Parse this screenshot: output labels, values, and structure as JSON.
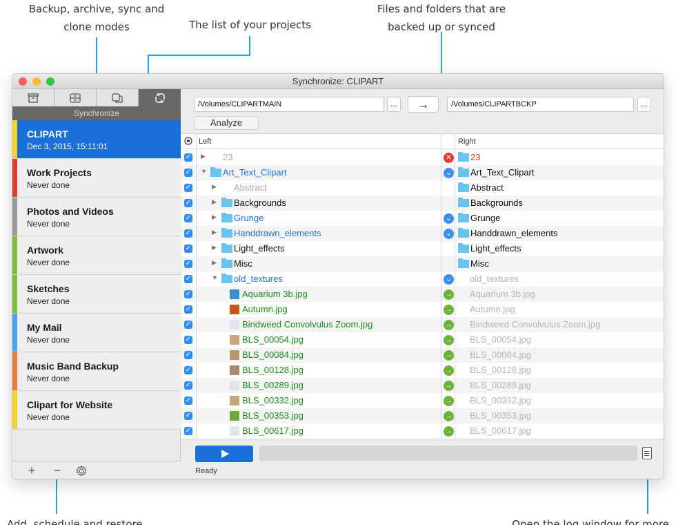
{
  "annotations": {
    "modes": "Backup, archive, sync and clone modes",
    "projects": "The list of your projects",
    "files": "Files and folders that are backed up or synced",
    "add": "Add, schedule and restore",
    "log": "Open the log window for more"
  },
  "window": {
    "title": "Synchronize: CLIPART"
  },
  "sidebar": {
    "mode_label": "Synchronize",
    "modes": [
      {
        "icon": "archive-box-icon"
      },
      {
        "icon": "backup-drive-icon"
      },
      {
        "icon": "clone-icon"
      },
      {
        "icon": "sync-arrows-icon"
      }
    ],
    "projects": [
      {
        "name": "CLIPART",
        "status": "Dec 3, 2015, 15:11:01",
        "color": "#f5d228",
        "selected": true
      },
      {
        "name": "Work Projects",
        "status": "Never done",
        "color": "#e0412f"
      },
      {
        "name": "Photos and Videos",
        "status": "Never done",
        "color": "#9a9a9a"
      },
      {
        "name": "Artwork",
        "status": "Never done",
        "color": "#7dbf3a"
      },
      {
        "name": "Sketches",
        "status": "Never done",
        "color": "#7dbf3a"
      },
      {
        "name": "My Mail",
        "status": "Never done",
        "color": "#4fa3f0"
      },
      {
        "name": "Music Band Backup",
        "status": "Never done",
        "color": "#f07a3a"
      },
      {
        "name": "Clipart for Website",
        "status": "Never done",
        "color": "#f5d228"
      }
    ],
    "footer": {
      "add": "+",
      "remove": "−"
    }
  },
  "main": {
    "left_path": "/Volumes/CLIPARTMAIN",
    "right_path": "/Volumes/CLIPARTBCKP",
    "browse_label": "...",
    "direction_label": "→",
    "analyze_label": "Analyze",
    "col_left": "Left",
    "col_right": "Right",
    "rows": [
      {
        "level": 0,
        "kind": "plain",
        "tri": "right",
        "left": "23",
        "lcolor": "#aaaaaa",
        "status": "error",
        "right": "23",
        "rcolor": "#d8401e",
        "rfolder": true
      },
      {
        "level": 0,
        "kind": "folder",
        "tri": "down",
        "left": "Art_Text_Clipart",
        "lcolor": "#1f72d6",
        "status": "sync",
        "right": "Art_Text_Clipart",
        "rcolor": "#111111",
        "rfolder": true
      },
      {
        "level": 1,
        "kind": "plain",
        "tri": "right",
        "left": "Abstract",
        "lcolor": "#aaaaaa",
        "status": "",
        "right": "Abstract",
        "rcolor": "#111111",
        "rfolder": true
      },
      {
        "level": 1,
        "kind": "folder",
        "tri": "right",
        "left": "Backgrounds",
        "lcolor": "#111111",
        "status": "",
        "right": "Backgrounds",
        "rcolor": "#111111",
        "rfolder": true
      },
      {
        "level": 1,
        "kind": "folder",
        "tri": "right",
        "left": "Grunge",
        "lcolor": "#1f72d6",
        "status": "sync",
        "right": "Grunge",
        "rcolor": "#111111",
        "rfolder": true
      },
      {
        "level": 1,
        "kind": "folder",
        "tri": "right",
        "left": "Handdrawn_elements",
        "lcolor": "#1f72d6",
        "status": "sync",
        "right": "Handdrawn_elements",
        "rcolor": "#111111",
        "rfolder": true
      },
      {
        "level": 1,
        "kind": "folder",
        "tri": "right",
        "left": "Light_effects",
        "lcolor": "#111111",
        "status": "",
        "right": "Light_effects",
        "rcolor": "#111111",
        "rfolder": true
      },
      {
        "level": 1,
        "kind": "folder",
        "tri": "right",
        "left": "Misc",
        "lcolor": "#111111",
        "status": "",
        "right": "Misc",
        "rcolor": "#111111",
        "rfolder": true
      },
      {
        "level": 1,
        "kind": "folder",
        "tri": "down",
        "left": "old_textures",
        "lcolor": "#1f72d6",
        "status": "sync",
        "right": "old_textures",
        "rcolor": "#b5b5b5",
        "rfolder": false
      },
      {
        "level": 2,
        "kind": "file",
        "thumb": "#3c8fd1",
        "left": "Aquarium 3b.jpg",
        "lcolor": "#1d8a1d",
        "status": "copy",
        "right": "Aquarium 3b.jpg",
        "rcolor": "#b5b5b5"
      },
      {
        "level": 2,
        "kind": "file",
        "thumb": "#c2561b",
        "left": "Autumn.jpg",
        "lcolor": "#1d8a1d",
        "status": "copy",
        "right": "Autumn.jpg",
        "rcolor": "#b5b5b5"
      },
      {
        "level": 2,
        "kind": "file",
        "thumb": "#dfe6ee",
        "left": "Bindweed Convolvulus Zoom.jpg",
        "lcolor": "#1d8a1d",
        "status": "copy",
        "right": "Bindweed Convolvulus Zoom.jpg",
        "rcolor": "#b5b5b5"
      },
      {
        "level": 2,
        "kind": "file",
        "thumb": "#c9a679",
        "left": "BLS_00054.jpg",
        "lcolor": "#1d8a1d",
        "status": "copy",
        "right": "BLS_00054.jpg",
        "rcolor": "#b5b5b5"
      },
      {
        "level": 2,
        "kind": "file",
        "thumb": "#b9976b",
        "left": "BLS_00084.jpg",
        "lcolor": "#1d8a1d",
        "status": "copy",
        "right": "BLS_00084.jpg",
        "rcolor": "#b5b5b5"
      },
      {
        "level": 2,
        "kind": "file",
        "thumb": "#a68a6b",
        "left": "BLS_00128.jpg",
        "lcolor": "#1d8a1d",
        "status": "copy",
        "right": "BLS_00128.jpg",
        "rcolor": "#b5b5b5"
      },
      {
        "level": 2,
        "kind": "file",
        "thumb": "#dfe6ee",
        "left": "BLS_00289.jpg",
        "lcolor": "#1d8a1d",
        "status": "copy",
        "right": "BLS_00289.jpg",
        "rcolor": "#b5b5b5"
      },
      {
        "level": 2,
        "kind": "file",
        "thumb": "#c7a57a",
        "left": "BLS_00332.jpg",
        "lcolor": "#1d8a1d",
        "status": "copy",
        "right": "BLS_00332.jpg",
        "rcolor": "#b5b5b5"
      },
      {
        "level": 2,
        "kind": "file",
        "thumb": "#6ea832",
        "left": "BLS_00353.jpg",
        "lcolor": "#1d8a1d",
        "status": "copy",
        "right": "BLS_00353.jpg",
        "rcolor": "#b5b5b5"
      },
      {
        "level": 2,
        "kind": "file",
        "thumb": "#dfe6ee",
        "left": "BLS_00617.jpg",
        "lcolor": "#1d8a1d",
        "status": "copy",
        "right": "BLS_00617.jpg",
        "rcolor": "#b5b5b5"
      }
    ],
    "status_text": "Ready",
    "status_colors": {
      "error": "#e0412f",
      "sync": "#3b8ff0",
      "copy": "#6cb33a"
    }
  }
}
